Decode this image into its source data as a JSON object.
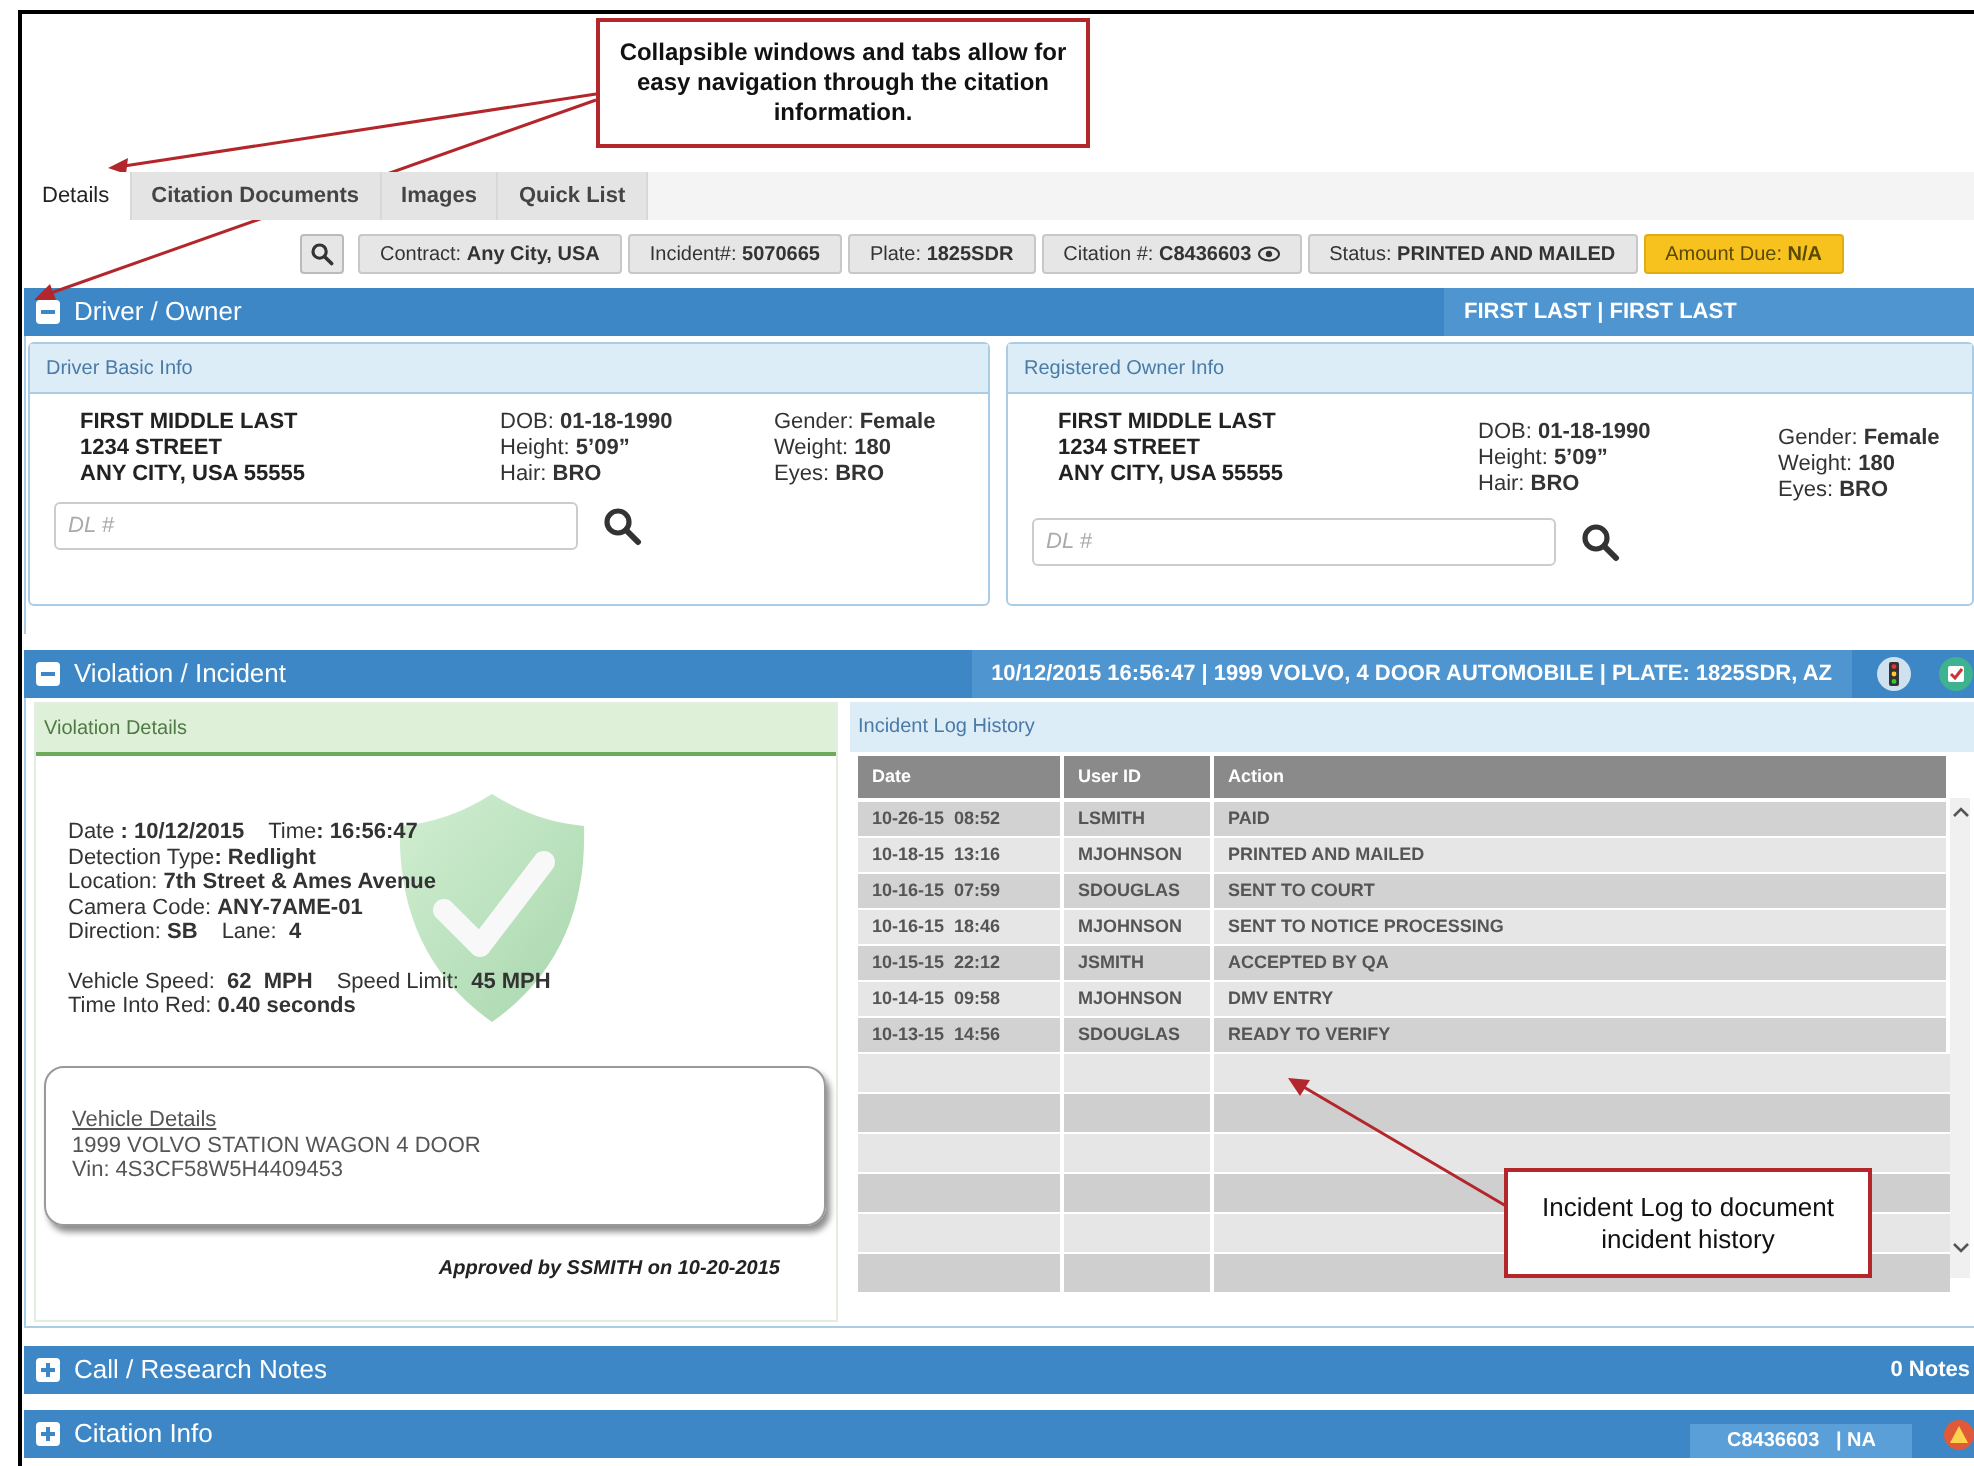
{
  "callouts": [
    {
      "text": "Collapsible windows and tabs allow for easy navigation through the citation information."
    },
    {
      "text": "Incident Log to document incident history"
    }
  ],
  "tabs": [
    {
      "label": "Details",
      "selected": true
    },
    {
      "label": "Citation Documents",
      "selected": false
    },
    {
      "label": "Images",
      "selected": false
    },
    {
      "label": "Quick List",
      "selected": false
    }
  ],
  "info_bar": [
    {
      "kind": "plain",
      "text": "Contract: **Any City, USA**"
    },
    {
      "kind": "plain",
      "text": "Incident#: **5070665**"
    },
    {
      "kind": "plain",
      "text": "Plate: **1825SDR**"
    },
    {
      "kind": "eye",
      "text": "Citation #: **C8436603**"
    },
    {
      "kind": "plain",
      "text": "Status: **PRINTED AND MAILED**"
    },
    {
      "kind": "highlight",
      "text": "Amount Due: **N/A**"
    }
  ],
  "driver_owner": {
    "title": "Driver / Owner",
    "expanded": true,
    "summary": "FIRST LAST | FIRST LAST",
    "panels": [
      {
        "title": "Driver Basic Info",
        "address": [
          "FIRST MIDDLE LAST",
          "1234 STREET",
          "ANY CITY, USA 55555"
        ],
        "col_1": [
          "DOB: **01-18-1990**",
          "Height: **5’09”**",
          "Hair: **BRO**"
        ],
        "col_2": [
          "Gender: **Female**",
          "Weight: **180**",
          "Eyes: **BRO**"
        ],
        "dl_placeholder": "DL #"
      },
      {
        "title": "Registered Owner Info",
        "address": [
          "FIRST MIDDLE LAST",
          "1234 STREET",
          "ANY CITY, USA 55555"
        ],
        "col_1": [
          "DOB: **01-18-1990**",
          "Height: **5’09”**",
          "Hair: **BRO**"
        ],
        "col_2": [
          "Gender: **Female**",
          "Weight: **180**",
          "Eyes: **BRO**"
        ],
        "dl_placeholder": "DL #"
      }
    ]
  },
  "violation": {
    "title": "Violation / Incident",
    "expanded": true,
    "summary": "10/12/2015 16:56:47 | 1999 VOLVO, 4 DOOR AUTOMOBILE | PLATE: 1825SDR, AZ",
    "details": {
      "title": "Violation Details",
      "lines": [
        [
          "Date **: 10/12/2015**",
          "Time**: 16:56:47**"
        ],
        [
          "Detection Type**: Redlight**"
        ],
        [
          "Location: **7th Street & Ames Avenue**"
        ],
        [
          "Camera Code: **ANY-7AME-01**"
        ],
        [
          "Direction: **SB**",
          "Lane:  **4**"
        ]
      ],
      "speed_lines": [
        [
          "Vehicle Speed:  **62  MPH**",
          "Speed Limit:  **45 MPH**"
        ],
        [
          "Time Into Red: **0.40 seconds**"
        ]
      ],
      "vehicle": {
        "title": "Vehicle Details",
        "lines": [
          "1999 VOLVO STATION WAGON 4 DOOR",
          "Vin: 4S3CF58W5H4409453"
        ]
      },
      "approval": "Approved by SSMITH on 10-20-2015"
    },
    "log": {
      "title": "Incident Log History",
      "columns": [
        "Date",
        "User ID",
        "Action"
      ],
      "rows": [
        [
          "10-26-15  08:52",
          "LSMITH",
          "PAID"
        ],
        [
          "10-18-15  13:16",
          "MJOHNSON",
          "PRINTED AND MAILED"
        ],
        [
          "10-16-15  07:59",
          "SDOUGLAS",
          "SENT TO COURT"
        ],
        [
          "10-16-15  18:46",
          "MJOHNSON",
          "SENT TO NOTICE PROCESSING"
        ],
        [
          "10-15-15  22:12",
          "JSMITH",
          "ACCEPTED BY QA"
        ],
        [
          "10-14-15  09:58",
          "MJOHNSON",
          "DMV ENTRY"
        ],
        [
          "10-13-15  14:56",
          "SDOUGLAS",
          "READY TO VERIFY"
        ]
      ]
    }
  },
  "collapsed_sections": [
    {
      "kind": "notes",
      "title": "Call / Research Notes",
      "expanded": false,
      "summary": "0 Notes"
    },
    {
      "kind": "citation",
      "title": "Citation Info",
      "expanded": false,
      "summary": "C8436603   | NA"
    }
  ]
}
